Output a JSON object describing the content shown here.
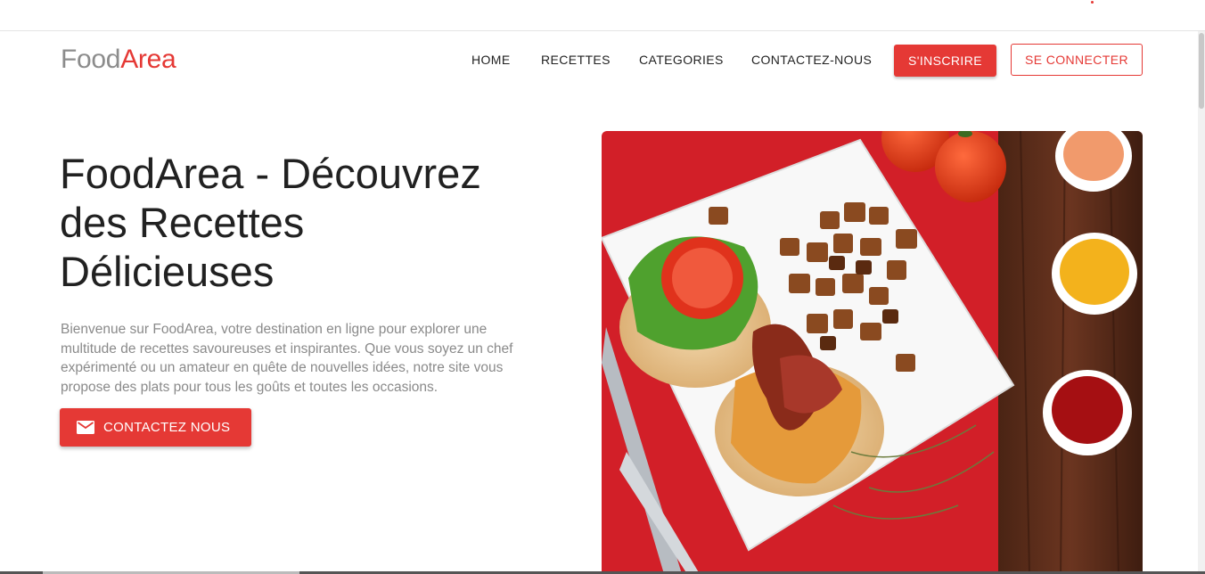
{
  "logo": {
    "part1": "Food",
    "part2": "Area"
  },
  "nav": {
    "home": "HOME",
    "recettes": "RECETTES",
    "categories": "CATEGORIES",
    "contact": "CONTACTEZ-NOUS",
    "signup": "S'INSCRIRE",
    "login": "SE CONNECTER"
  },
  "hero": {
    "title": "FoodArea - Découvrez des Recettes Délicieuses",
    "text": "Bienvenue sur FoodArea, votre destination en ligne pour explorer une multitude de recettes savoureuses et inspirantes. Que vous soyez un chef expérimenté ou un amateur en quête de nouvelles idées, notre site vous propose des plats pour tous les goûts et toutes les occasions.",
    "cta": "CONTACTEZ NOUS",
    "cta_icon": "mail-icon",
    "image_icon": "food-photo"
  },
  "colors": {
    "accent": "#e53935",
    "logo_gray": "#8c8c8c",
    "text_gray": "#8a8a8a"
  }
}
